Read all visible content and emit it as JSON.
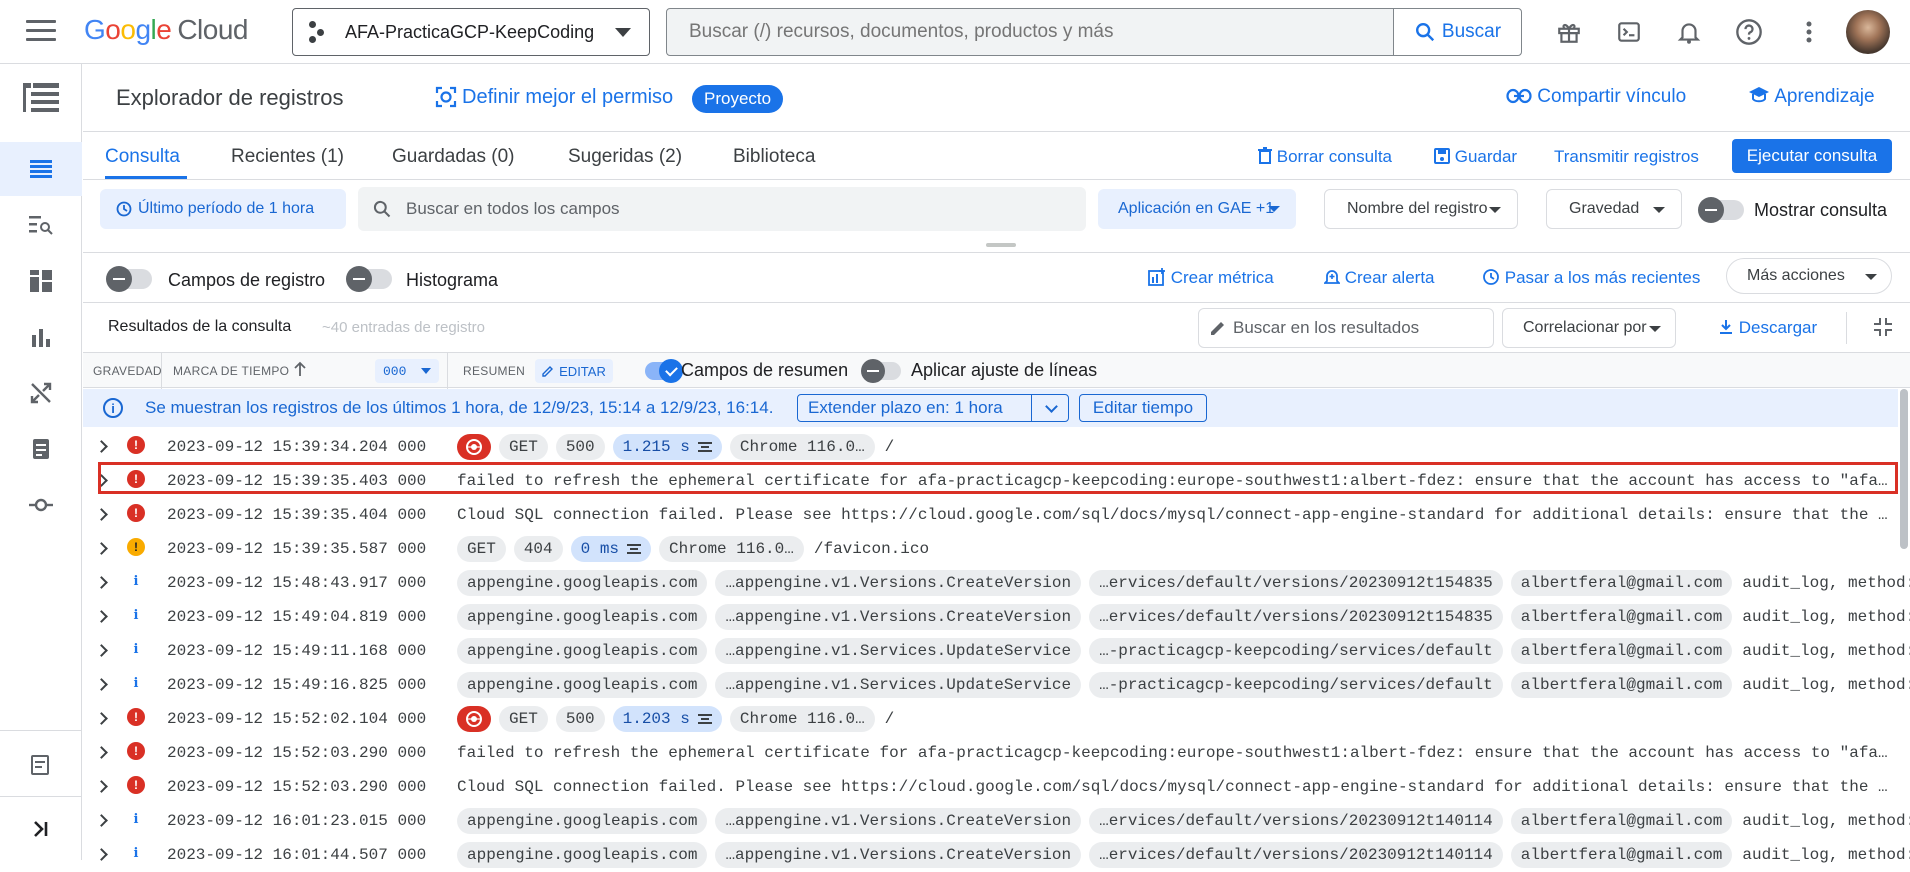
{
  "topbar": {
    "logo": {
      "g": "G",
      "o1": "o",
      "o2": "o",
      "g2": "g",
      "l": "l",
      "e": "e",
      "cloud": "Cloud"
    },
    "project": "AFA-PracticaGCP-KeepCoding",
    "search_placeholder": "Buscar (/) recursos, documentos, productos y más",
    "search_button": "Buscar"
  },
  "header": {
    "title": "Explorador de registros",
    "scope_link": "Definir mejor el permiso",
    "scope_badge": "Proyecto",
    "share": "Compartir vínculo",
    "learn": "Aprendizaje"
  },
  "tabs": [
    "Consulta",
    "Recientes (1)",
    "Guardadas (0)",
    "Sugeridas (2)",
    "Biblioteca"
  ],
  "query_actions": {
    "clear": "Borrar consulta",
    "save": "Guardar",
    "stream": "Transmitir registros",
    "run": "Ejecutar consulta"
  },
  "filters": {
    "time": "Último período de 1 hora",
    "search_placeholder": "Buscar en todos los campos",
    "resource": "Aplicación en GAE +1",
    "log_name": "Nombre del registro",
    "severity": "Gravedad",
    "show_query": "Mostrar consulta"
  },
  "toolbar": {
    "log_fields": "Campos de registro",
    "histogram": "Histograma",
    "create_metric": "Crear métrica",
    "create_alert": "Crear alerta",
    "jump_recent": "Pasar a los más recientes",
    "more_actions": "Más acciones"
  },
  "results": {
    "title": "Resultados de la consulta",
    "count": "~40 entradas de registro",
    "search_placeholder": "Buscar en los resultados",
    "correlate": "Correlacionar por",
    "download": "Descargar"
  },
  "table_header": {
    "severity": "GRAVEDAD",
    "timestamp": "MARCA DE TIEMPO",
    "tz": "000",
    "summary": "RESUMEN",
    "edit": "EDITAR",
    "summary_fields": "Campos de resumen",
    "wrap_lines": "Aplicar ajuste de líneas"
  },
  "banner": {
    "text": "Se muestran los registros de los últimos 1 hora, de 12/9/23, 15:14 a 12/9/23, 16:14.",
    "extend": "Extender plazo en: 1 hora",
    "edit_time": "Editar tiempo"
  },
  "rows": [
    {
      "severity": "error",
      "time": "2023-09-12 15:39:34.204 000",
      "chips": [
        "GET",
        "500",
        "1.215 s",
        "Chrome 116.0…"
      ],
      "path": "/",
      "redicon": true
    },
    {
      "severity": "error",
      "time": "2023-09-12 15:39:35.403 000",
      "message": "failed to refresh the ephemeral certificate for afa-practicagcp-keepcoding:europe-southwest1:albert-fdez: ensure that the account has access to \"afa-practic…"
    },
    {
      "severity": "error",
      "time": "2023-09-12 15:39:35.404 000",
      "message": "Cloud SQL connection failed. Please see https://cloud.google.com/sql/docs/mysql/connect-app-engine-standard for additional details: ensure that the account …"
    },
    {
      "severity": "warning",
      "time": "2023-09-12 15:39:35.587 000",
      "chips": [
        "GET",
        "404",
        "0 ms",
        "Chrome 116.0…"
      ],
      "path": "/favicon.ico"
    },
    {
      "severity": "info",
      "time": "2023-09-12 15:48:43.917 000",
      "chips": [
        "appengine.googleapis.com",
        "…appengine.v1.Versions.CreateVersion",
        "…ervices/default/versions/20230912t154835",
        "albertferal@gmail.com"
      ],
      "path": "audit_log, method: \"go…"
    },
    {
      "severity": "info",
      "time": "2023-09-12 15:49:04.819 000",
      "chips": [
        "appengine.googleapis.com",
        "…appengine.v1.Versions.CreateVersion",
        "…ervices/default/versions/20230912t154835",
        "albertferal@gmail.com"
      ],
      "path": "audit_log, method: \"go…"
    },
    {
      "severity": "info",
      "time": "2023-09-12 15:49:11.168 000",
      "chips": [
        "appengine.googleapis.com",
        "…appengine.v1.Services.UpdateService",
        "…-practicagcp-keepcoding/services/default",
        "albertferal@gmail.com"
      ],
      "path": "audit_log, method: \"go…"
    },
    {
      "severity": "info",
      "time": "2023-09-12 15:49:16.825 000",
      "chips": [
        "appengine.googleapis.com",
        "…appengine.v1.Services.UpdateService",
        "…-practicagcp-keepcoding/services/default",
        "albertferal@gmail.com"
      ],
      "path": "audit_log, method: \"go…"
    },
    {
      "severity": "error",
      "time": "2023-09-12 15:52:02.104 000",
      "chips": [
        "GET",
        "500",
        "1.203 s",
        "Chrome 116.0…"
      ],
      "path": "/",
      "redicon": true
    },
    {
      "severity": "error",
      "time": "2023-09-12 15:52:03.290 000",
      "message": "failed to refresh the ephemeral certificate for afa-practicagcp-keepcoding:europe-southwest1:albert-fdez: ensure that the account has access to \"afa-practic…"
    },
    {
      "severity": "error",
      "time": "2023-09-12 15:52:03.290 000",
      "message": "Cloud SQL connection failed. Please see https://cloud.google.com/sql/docs/mysql/connect-app-engine-standard for additional details: ensure that the account …"
    },
    {
      "severity": "info",
      "time": "2023-09-12 16:01:23.015 000",
      "chips": [
        "appengine.googleapis.com",
        "…appengine.v1.Versions.CreateVersion",
        "…ervices/default/versions/20230912t140114",
        "albertferal@gmail.com"
      ],
      "path": "audit_log, method: \"go…"
    },
    {
      "severity": "info",
      "time": "2023-09-12 16:01:44.507 000",
      "chips": [
        "appengine.googleapis.com",
        "…appengine.v1.Versions.CreateVersion",
        "…ervices/default/versions/20230912t140114",
        "albertferal@gmail.com"
      ],
      "path": "audit_log, method: \"go…"
    }
  ],
  "colors": {
    "accent": "#1a73e8",
    "error": "#d93025",
    "warning": "#f9ab00",
    "highlight_border": "#d93025"
  }
}
